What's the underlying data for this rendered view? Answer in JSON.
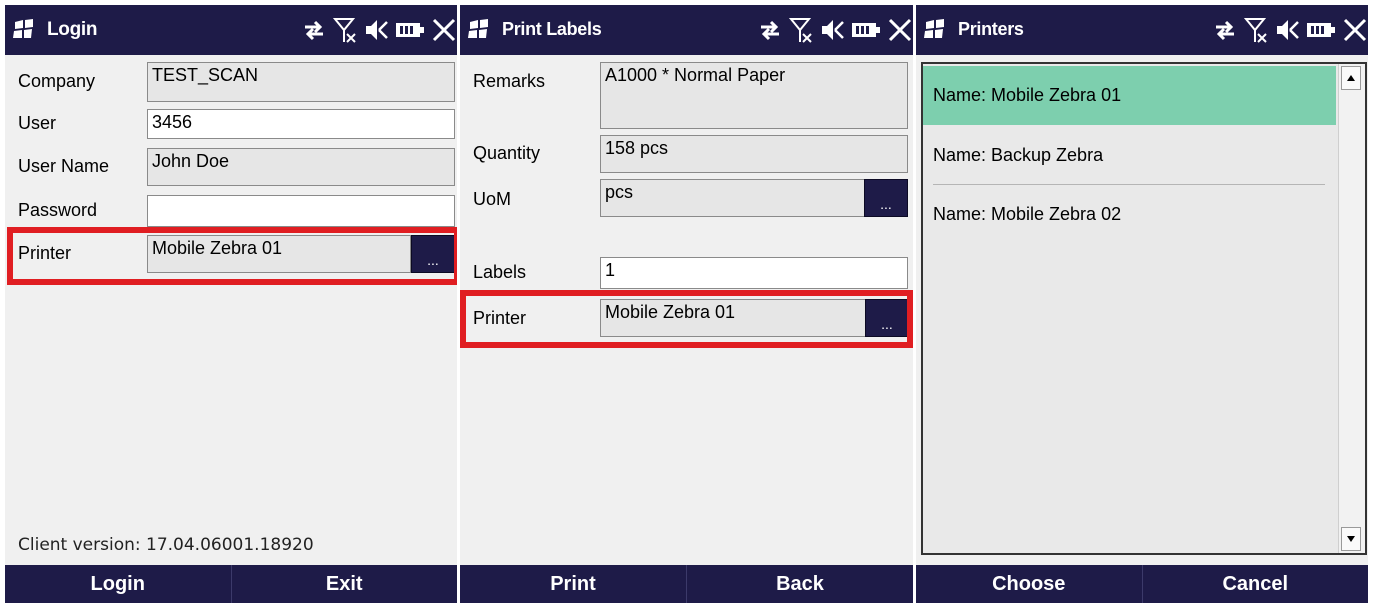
{
  "colors": {
    "bar": "#1e1b48",
    "highlight": "#e01e22",
    "selected_row": "#7dcfae"
  },
  "tray_icons": [
    "sync-arrows-icon",
    "no-signal-icon",
    "volume-icon",
    "battery-icon",
    "close-icon"
  ],
  "login": {
    "title": "Login",
    "company_label": "Company",
    "company_value": "TEST_SCAN",
    "user_label": "User",
    "user_value": "3456",
    "username_label": "User Name",
    "username_value": "John Doe",
    "password_label": "Password",
    "password_value": "",
    "printer_label": "Printer",
    "printer_value": "Mobile Zebra 01",
    "browse": "...",
    "version": "Client version: 17.04.06001.18920",
    "buttons": [
      "Login",
      "Exit"
    ]
  },
  "print_labels": {
    "title": "Print Labels",
    "remarks_label": "Remarks",
    "remarks_value": "A1000 * Normal Paper",
    "quantity_label": "Quantity",
    "quantity_value": "158 pcs",
    "uom_label": "UoM",
    "uom_value": "pcs",
    "labels_label": "Labels",
    "labels_value": "1",
    "printer_label": "Printer",
    "printer_value": "Mobile Zebra 01",
    "browse": "...",
    "buttons": [
      "Print",
      "Back"
    ]
  },
  "printers": {
    "title": "Printers",
    "items": [
      "Name: Mobile Zebra 01",
      "Name: Backup Zebra",
      "Name: Mobile Zebra 02"
    ],
    "selected_index": 0,
    "buttons": [
      "Choose",
      "Cancel"
    ]
  }
}
